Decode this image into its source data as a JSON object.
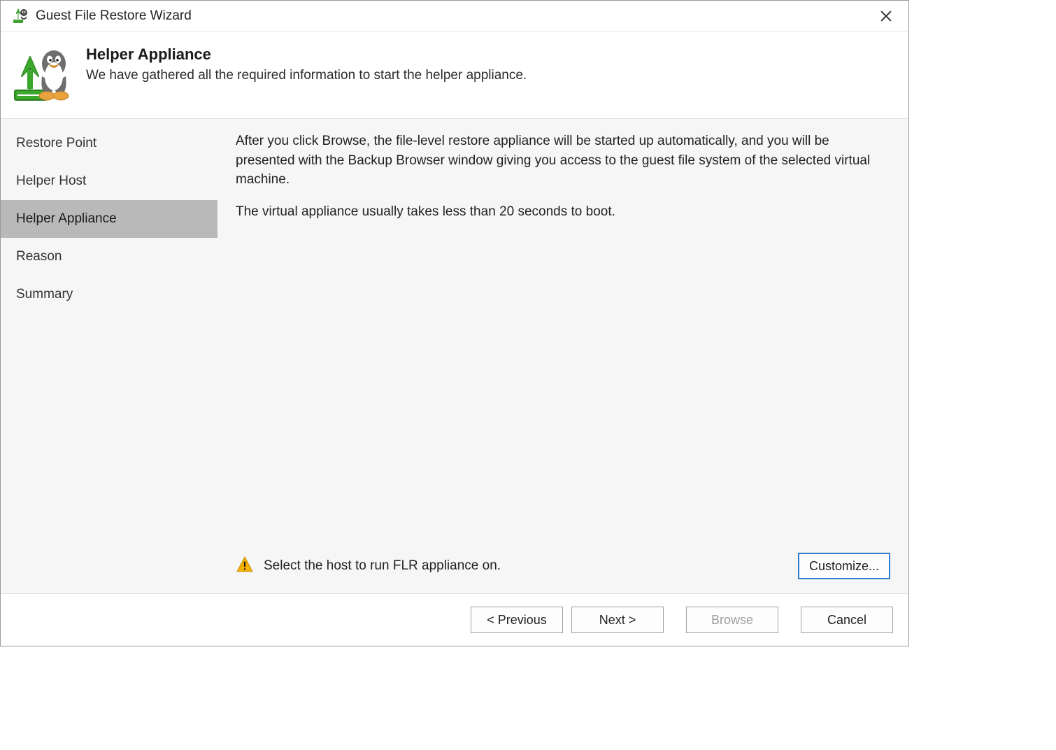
{
  "window": {
    "title": "Guest File Restore Wizard"
  },
  "header": {
    "heading": "Helper Appliance",
    "sub": "We have gathered all the required information to start the helper appliance."
  },
  "sidebar": {
    "items": [
      {
        "label": "Restore Point"
      },
      {
        "label": "Helper Host"
      },
      {
        "label": "Helper Appliance"
      },
      {
        "label": "Reason"
      },
      {
        "label": "Summary"
      }
    ],
    "selected_index": 2
  },
  "main": {
    "para1": "After you click Browse, the file-level restore appliance will be started up automatically, and you will be presented with the Backup Browser window giving you access to the guest file system of the selected virtual machine.",
    "para2": "The virtual appliance usually takes less than 20 seconds to boot.",
    "warning": "Select the host to run FLR appliance on.",
    "customize_label": "Customize..."
  },
  "footer": {
    "previous": "< Previous",
    "next": "Next >",
    "browse": "Browse",
    "cancel": "Cancel",
    "browse_enabled": false
  }
}
